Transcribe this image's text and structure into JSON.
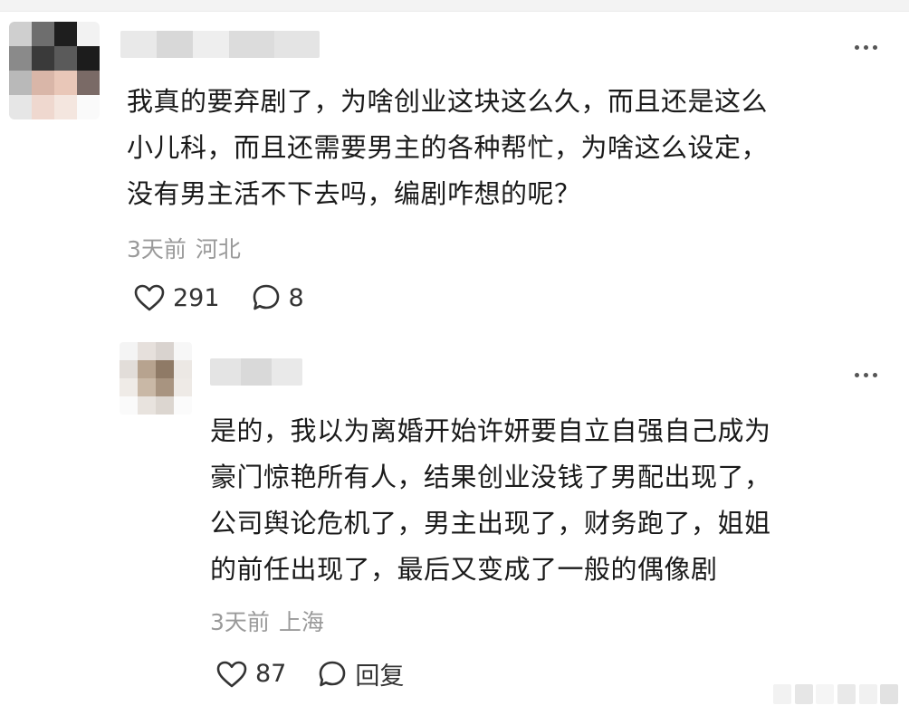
{
  "comments": [
    {
      "text": "我真的要弃剧了，为啥创业这块这么久，而且还是这么\n小儿科，而且还需要男主的各种帮忙，为啥这么设定，\n没有男主活不下去吗，编剧咋想的呢？",
      "time": "3天前",
      "location": "河北",
      "likes": "291",
      "replies": "8",
      "more_icon": "more-dots-icon"
    },
    {
      "text": "是的，我以为离婚开始许妍要自立自强自己成为\n豪门惊艳所有人，结果创业没钱了男配出现了，\n公司舆论危机了，男主出现了，财务跑了，姐姐\n的前任出现了，最后又变成了一般的偶像剧",
      "time": "3天前",
      "location": "上海",
      "likes": "87",
      "reply_label": "回复",
      "more_icon": "more-dots-icon"
    }
  ],
  "colors": {
    "text": "#1a1a1a",
    "meta": "#9a9a9a",
    "icon": "#333333"
  }
}
